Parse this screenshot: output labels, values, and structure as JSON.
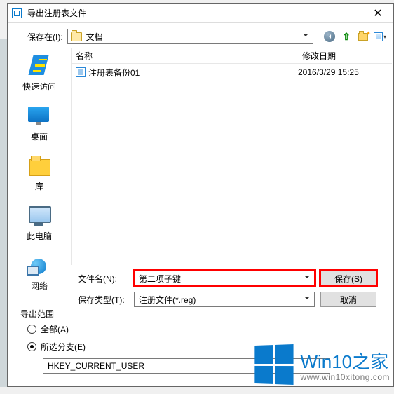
{
  "title": "导出注册表文件",
  "location": {
    "label": "保存在(I):",
    "value": "文档"
  },
  "nav_icons": {
    "back": "back-icon",
    "up": "up-level-icon",
    "new_folder": "new-folder-icon",
    "view": "view-icon"
  },
  "sidebar": {
    "items": [
      {
        "id": "quick",
        "label": "快速访问"
      },
      {
        "id": "desktop",
        "label": "桌面"
      },
      {
        "id": "libraries",
        "label": "库"
      },
      {
        "id": "thispc",
        "label": "此电脑"
      },
      {
        "id": "network",
        "label": "网络"
      }
    ]
  },
  "columns": {
    "name": "名称",
    "date": "修改日期"
  },
  "files": [
    {
      "name": "注册表备份01",
      "date": "2016/3/29 15:25"
    }
  ],
  "filename": {
    "label": "文件名(N):",
    "value": "第二项子键"
  },
  "filetype": {
    "label": "保存类型(T):",
    "value": "注册文件(*.reg)"
  },
  "buttons": {
    "save": "保存(S)",
    "cancel": "取消"
  },
  "scope": {
    "title": "导出范围",
    "all_label": "全部(A)",
    "branch_label": "所选分支(E)",
    "selected": "branch",
    "branch_value": "HKEY_CURRENT_USER"
  },
  "watermark": {
    "brand": "Win10",
    "zh": "之家",
    "url": "www.win10xitong.com"
  }
}
